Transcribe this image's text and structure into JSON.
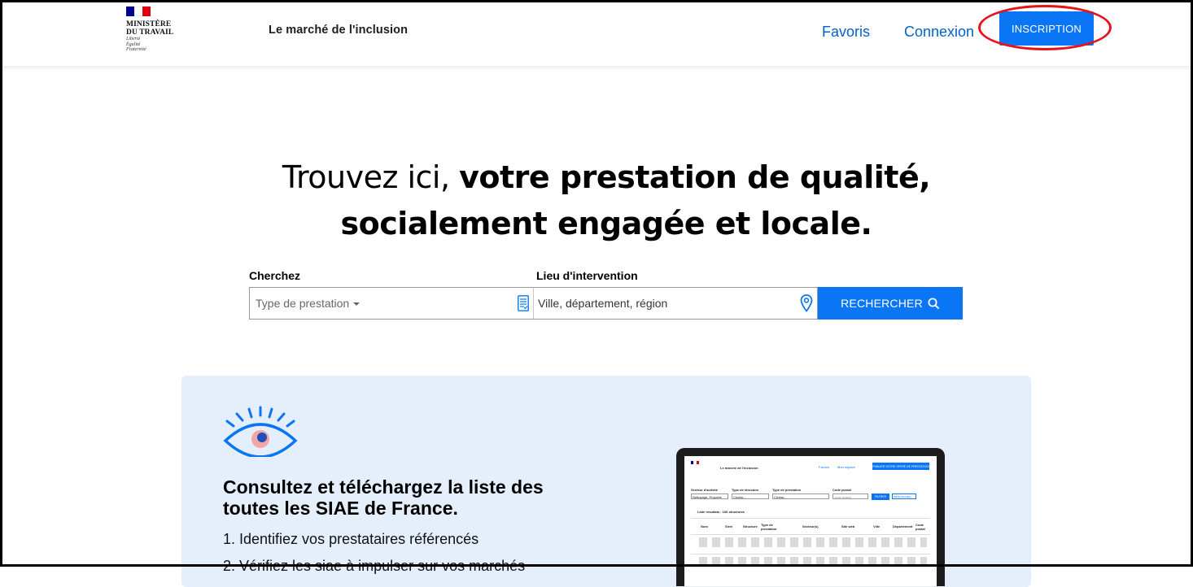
{
  "header": {
    "logo": {
      "line1": "MINISTÈRE",
      "line2": "DU TRAVAIL",
      "motto1": "Liberté",
      "motto2": "Égalité",
      "motto3": "Fraternité",
      "flag_colors": [
        "#000091",
        "#ffffff",
        "#e1000f"
      ]
    },
    "site_name": "Le marché de l'inclusion",
    "nav": {
      "favoris": "Favoris",
      "connexion": "Connexion",
      "inscription": "INSCRIPTION"
    },
    "highlight_color": "#e8131a"
  },
  "hero": {
    "title_light": "Trouvez ici, ",
    "title_bold_1": "votre prestation de qualité,",
    "title_bold_2": "socialement engagée et locale."
  },
  "search": {
    "label_search": "Cherchez",
    "label_lieu": "Lieu d'intervention",
    "type_placeholder": "Type de prestation",
    "lieu_placeholder": "Ville, département, région",
    "button": "RECHERCHER",
    "accent": "#0a76f6"
  },
  "info_card": {
    "title": "Consultez et téléchargez la liste des toutes les SIAE de France.",
    "items": [
      "1. Identifiez vos prestataires référencés",
      "2. Vérifiez les siae à impulser sur vos marchés"
    ],
    "background": "#e5effb"
  },
  "laptop_preview": {
    "site_name": "Le marché de l'inclusion",
    "nav_favoris": "Favoris",
    "nav_account": "Mon espace",
    "cta": "PUBLIER VOTRE OFFRE DE PRESTATION",
    "filters": [
      "Secteur d'activité",
      "Type de structure",
      "Type de prestation",
      "Code postal"
    ],
    "filter_values": [
      "Nettoyage, Propreté",
      "Choisir...",
      "Choisir...",
      "code postal"
    ],
    "filter_button": "FILTRER",
    "reset_button": "RÉINITIALISER",
    "list_title": "Liste résultats : 106 structures",
    "columns": [
      "Nom",
      "Siret",
      "Structure",
      "Type de prestation",
      "Secteur(s)",
      "Site web",
      "Ville",
      "Département",
      "Code postal"
    ]
  }
}
